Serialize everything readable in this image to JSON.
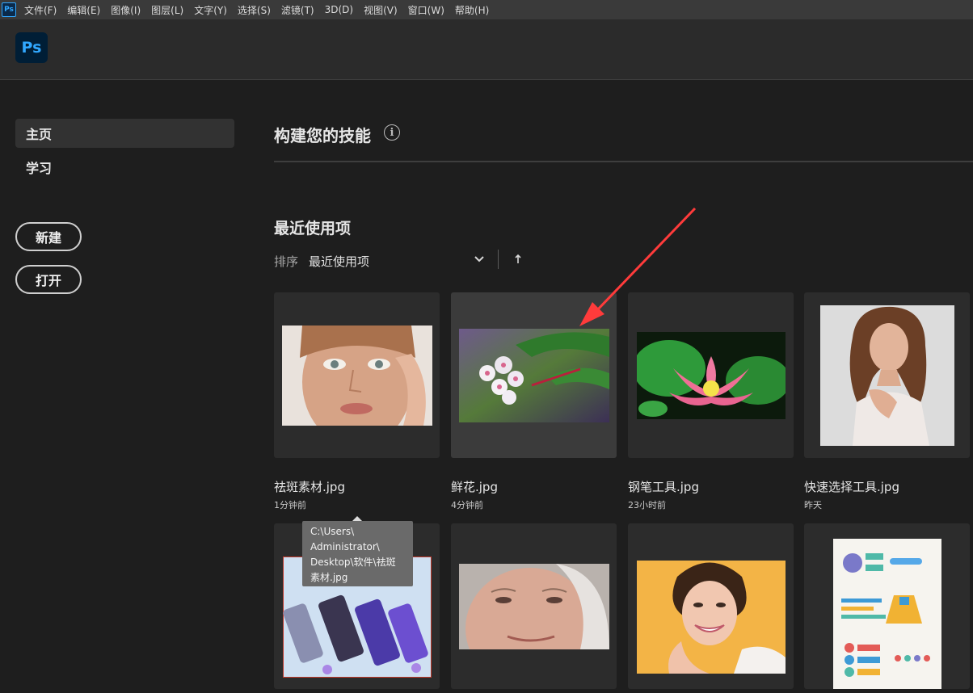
{
  "menubar": {
    "items": [
      "文件(F)",
      "编辑(E)",
      "图像(I)",
      "图层(L)",
      "文字(Y)",
      "选择(S)",
      "滤镜(T)",
      "3D(D)",
      "视图(V)",
      "窗口(W)",
      "帮助(H)"
    ]
  },
  "header": {
    "logo": "Ps"
  },
  "sidebar": {
    "nav": [
      {
        "label": "主页",
        "active": true
      },
      {
        "label": "学习",
        "active": false
      }
    ],
    "new_label": "新建",
    "open_label": "打开"
  },
  "main": {
    "skills_title": "构建您的技能",
    "info_glyph": "i",
    "recent_title": "最近使用项",
    "sort_label": "排序",
    "sort_value": "最近使用项"
  },
  "files": [
    {
      "name": "祛斑素材.jpg",
      "time": "1分钟前"
    },
    {
      "name": "鲜花.jpg",
      "time": "4分钟前"
    },
    {
      "name": "钢笔工具.jpg",
      "time": "23小时前"
    },
    {
      "name": "快速选择工具.jpg",
      "time": "昨天"
    }
  ],
  "tooltip": {
    "lines": [
      "C:\\Users\\",
      "Administrator\\",
      "Desktop\\软件\\祛斑",
      "素材.jpg"
    ]
  },
  "colors": {
    "accent": "#31a8ff",
    "annotation_arrow": "#ff3b3b",
    "background": "#1e1e1e"
  }
}
